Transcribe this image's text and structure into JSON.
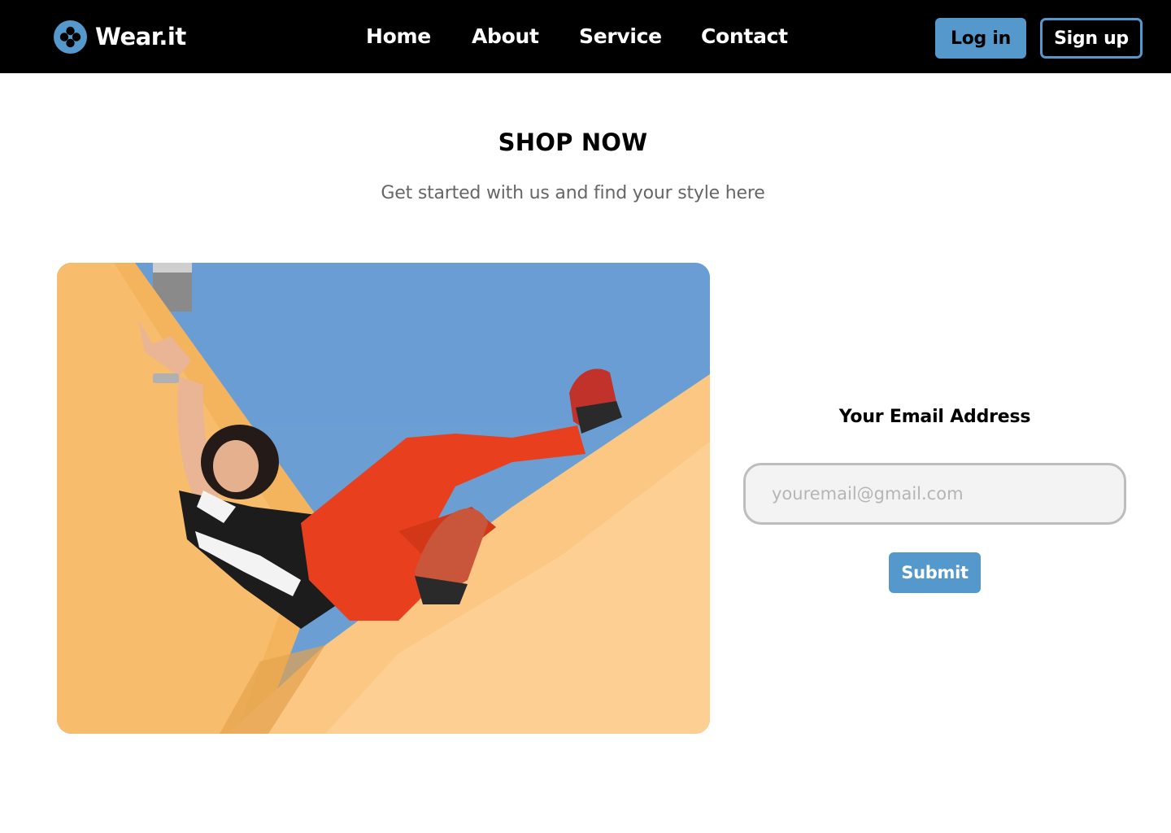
{
  "header": {
    "brand": {
      "name": "Wear.it",
      "icon": "brand-logo-icon"
    },
    "nav": [
      {
        "label": "Home"
      },
      {
        "label": "About"
      },
      {
        "label": "Service"
      },
      {
        "label": "Contact"
      }
    ],
    "login_label": "Log in",
    "signup_label": "Sign up"
  },
  "main": {
    "title": "SHOP NOW",
    "subtitle": "Get started with us and find your style here"
  },
  "form": {
    "email_label": "Your Email Address",
    "email_placeholder": "youremail@gmail.com",
    "email_value": "",
    "submit_label": "Submit"
  },
  "colors": {
    "navbar_bg": "#000000",
    "accent": "#5599cc",
    "subtitle_text": "#666666",
    "input_bg": "#f3f3f3"
  }
}
